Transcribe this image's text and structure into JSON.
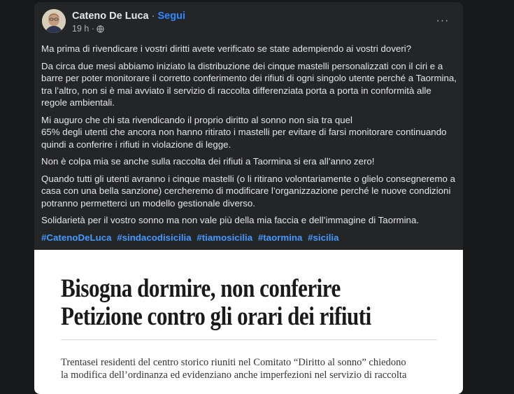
{
  "post": {
    "author": "Cateno De Luca",
    "separator": "·",
    "follow_label": "Segui",
    "time": "19 h ·",
    "more_icon": "···",
    "paragraphs": [
      "Ma prima di rivendicare i vostri diritti avete verificato se state adempiendo ai vostri doveri?",
      "Da circa due mesi abbiamo iniziato la distribuzione dei cinque mastelli personalizzati con il ciri e a barre  per poter monitorare il corretto conferimento dei rifiuti di ogni singolo utente perché a Taormina, tra l’altro, non si è mai avviato il servizio di raccolta differenziata porta a porta in conformità alle regole ambientali.",
      "Mi auguro che chi sta rivendicando il proprio diritto al sonno non sia tra quel\n65% degli utenti che  ancora non hanno ritirato i mastelli per evitare di farsi monitorare continuando quindi a conferire i rifiuti in violazione di legge.",
      "Non è colpa mia se anche sulla raccolta dei  rifiuti a Taormina si era all’anno zero!",
      "Quando tutti gli utenti avranno i cinque mastelli (o li ritirano volontariamente o glielo consegneremo a casa con una bella sanzione) cercheremo di modificare l’organizzazione perché le nuove condizioni potranno permetterci un modello gestionale diverso.",
      "Solidarietà per il vostro sonno ma non vale più della mia faccia e dell’immagine di Taormina."
    ],
    "hashtags": [
      "#CatenoDeLuca",
      "#sindacodisicilia",
      "#tiamosicilia",
      "#taormina",
      "#sicilia"
    ]
  },
  "photo": {
    "headline_line1": "Bisogna dormire, non conferire",
    "headline_line2": "Petizione contro gli orari dei rifiuti",
    "subhead": "Trentasei residenti del centro storico riuniti nel Comitato “Diritto al sonno” chiedono\nla modifica dell’ordinanza ed evidenziano anche imperfezioni nel servizio di raccolta"
  },
  "colors": {
    "background": "#18191a",
    "card": "#242526",
    "text": "#e4e6eb",
    "secondary": "#b0b3b8",
    "link": "#2d88ff",
    "hashtag": "#4599ff"
  },
  "icons": [
    "avatar",
    "globe-icon",
    "more-options-icon"
  ]
}
